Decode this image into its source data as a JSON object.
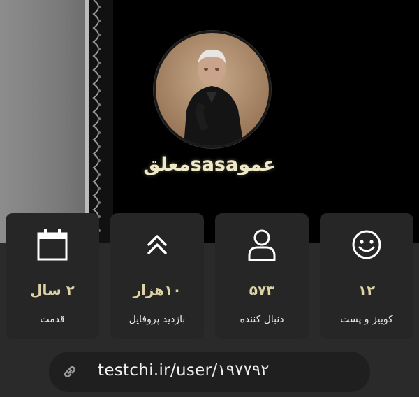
{
  "profile": {
    "username": "عموsasaمعلق"
  },
  "stats": [
    {
      "icon": "smile-icon",
      "value": "۱۲",
      "label": "کوییز و پست"
    },
    {
      "icon": "user-icon",
      "value": "۵۷۳",
      "label": "دنبال کننده"
    },
    {
      "icon": "double-chevron-up-icon",
      "value": "۱۰هزار",
      "label": "بازدید پروفایل"
    },
    {
      "icon": "calendar-icon",
      "value": "۲ سال",
      "label": "قدمت"
    }
  ],
  "link": {
    "icon": "link-icon",
    "url": "testchi.ir/user/۱۹۷۷۹۲"
  },
  "colors": {
    "accent_text": "#ddd3a6",
    "card_bg": "#262626",
    "page_bg": "#2a2a2a"
  }
}
